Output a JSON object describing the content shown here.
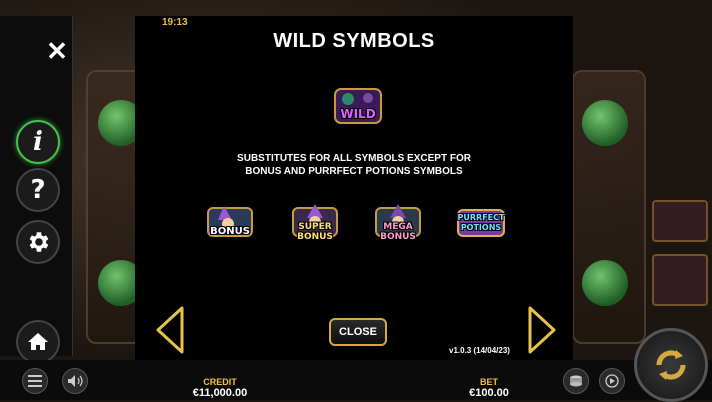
{
  "clock": "19:13",
  "title": "WILD SYMBOLS",
  "wild_symbol": {
    "label": "WILD",
    "icon": "wild-symbol-icon"
  },
  "description": {
    "line1": "SUBSTITUTES FOR ALL SYMBOLS EXCEPT FOR",
    "line2": "BONUS AND PURRFECT POTIONS SYMBOLS"
  },
  "excepted_symbols": [
    {
      "line1": "BONUS",
      "line2": "",
      "icon": "bonus-symbol-icon"
    },
    {
      "line1": "SUPER",
      "line2": "BONUS",
      "icon": "super-bonus-symbol-icon"
    },
    {
      "line1": "MEGA",
      "line2": "BONUS",
      "icon": "mega-bonus-symbol-icon"
    },
    {
      "line1": "PURRFECT",
      "line2": "POTIONS",
      "icon": "purrfect-potions-symbol-icon"
    }
  ],
  "close_label": "CLOSE",
  "version": "v1.0.3 (14/04/23)",
  "credit": {
    "label": "CREDIT",
    "value": "€11,000.00"
  },
  "bet": {
    "label": "BET",
    "value": "€100.00"
  },
  "colors": {
    "accent_gold": "#d6a840",
    "label_yellow": "#f0c040",
    "info_green": "#49c24d"
  }
}
